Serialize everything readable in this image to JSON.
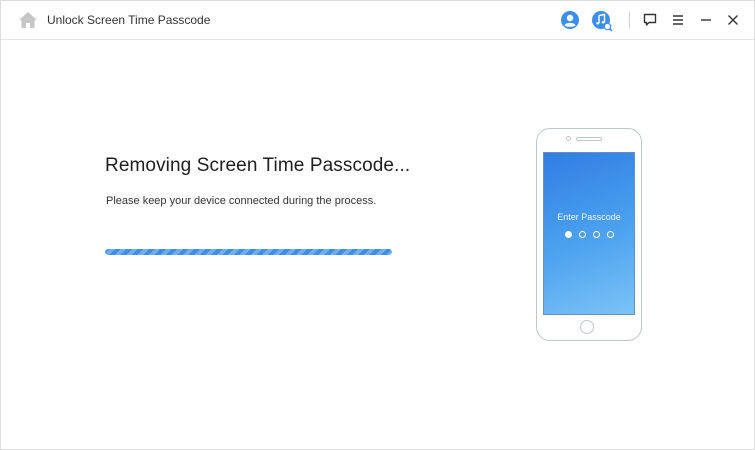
{
  "window": {
    "title": "Unlock Screen Time Passcode"
  },
  "toolbar": {
    "icons": [
      "home-icon",
      "user-avatar-icon",
      "music-icon",
      "feedback-icon",
      "menu-icon",
      "minimize-icon",
      "close-icon"
    ]
  },
  "main": {
    "heading": "Removing Screen Time Passcode...",
    "subtext": "Please keep your device connected during the process.",
    "progress": 1.0
  },
  "phone": {
    "screen_label": "Enter Passcode",
    "passcode_dots_total": 4,
    "passcode_dots_filled": 1
  },
  "colors": {
    "accent": "#3b8fe8",
    "icon_blue": "#3b8fe8",
    "icon_gray": "#c6c6c6"
  }
}
